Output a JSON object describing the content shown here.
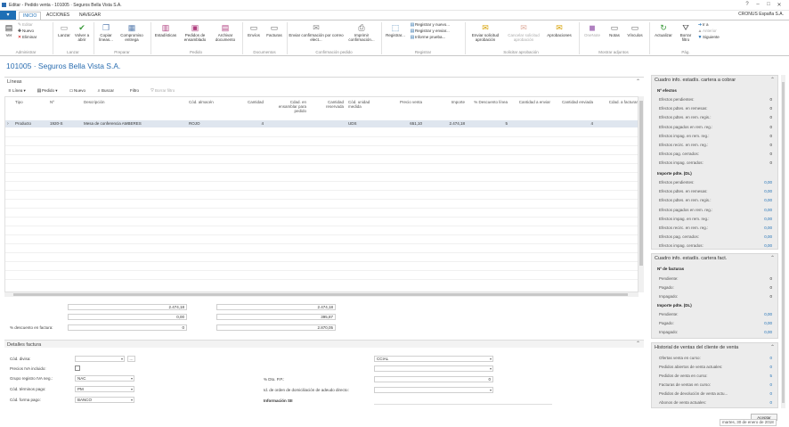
{
  "window": {
    "title": "Editar - Pedido venta - 101005 · Seguros Bella Vista S.A.",
    "company": "CRONUS España S.A."
  },
  "tabs": [
    "INICIO",
    "ACCIONES",
    "NAVEGAR"
  ],
  "ribbon": {
    "ver": "Ver",
    "editar": "Editar",
    "nuevo": "Nuevo",
    "eliminar": "Eliminar",
    "g_admin": "Administrar",
    "lanzar": "Lanzar",
    "volver_abrir": "Volver a abrir",
    "g_lanzar": "Lanzar",
    "copiar_lineas": "Copiar líneas...",
    "compromiso_entrega": "Compromiso entrega",
    "g_preparar": "Preparar",
    "estadisticas": "Estadísticas",
    "pedidos_ensamblado": "Pedidos de ensamblado",
    "archivar_doc": "Archivar documento",
    "g_pedido": "Pedido",
    "envios": "Envíos",
    "facturas": "Facturas",
    "g_documentos": "Documentos",
    "enviar_confirmacion": "Enviar confirmación por correo elect...",
    "imprimir_confirmacion": "Imprimir confirmación...",
    "g_confirmacion": "Confirmación pedido",
    "registrar": "Registrar...",
    "registrar_nuevo": "Registrar y nuevo...",
    "registrar_enviar": "Registrar y enviar...",
    "informe_prueba": "Informe prueba...",
    "g_registrar": "Registrar",
    "enviar_sol": "Enviar solicitud aprobación",
    "cancelar_sol": "Cancelar solicitud aprobación",
    "aprobaciones": "Aprobaciones",
    "g_sol": "Solicitar aprobación",
    "onenote": "OneNote",
    "notas": "Notas",
    "vinculos": "Vínculos",
    "g_adjuntos": "Mostrar adjuntos",
    "actualizar": "Actualizar",
    "borrar_filtro": "Borrar filtro",
    "ir_a": "Ir a",
    "anterior": "Anterior",
    "siguiente": "Siguiente",
    "g_pag": "Pág."
  },
  "doc_title": "101005 · Seguros Bella Vista S.A.",
  "lines": {
    "section": "Líneas",
    "toolbar": {
      "linea": "Línea",
      "pedido": "Pedido",
      "nuevo": "Nuevo",
      "buscar": "Buscar",
      "filtro": "Filtro",
      "borrar_filtro": "Borrar filtro"
    },
    "columns": [
      "Tipo",
      "Nº",
      "Descripción",
      "Cód. almacén",
      "Cantidad",
      "Cdad. en ensamblar para pedido",
      "Cantidad reservada",
      "Cód. unidad medida",
      "Precio venta",
      "Importe",
      "% Descuento línea",
      "Cantidad a enviar",
      "Cantidad enviada",
      "Cdad. a facturar"
    ],
    "rows": [
      {
        "tipo": "Producto",
        "no": "1920-S",
        "descripcion": "Mesa de conferencia AMBERES",
        "almacen": "ROJO",
        "cantidad": "4",
        "unidad": "UDS",
        "precio": "651,10",
        "importe": "2.474,18",
        "descuento": "5",
        "cdad_facturar": "4"
      }
    ]
  },
  "totals": {
    "left": [
      "2.474,18",
      "0,00",
      "0"
    ],
    "left_label3": "% descuento en factura:",
    "right": [
      "2.474,18",
      "395,87",
      "2.870,05"
    ]
  },
  "details": {
    "section": "Detalles factura",
    "cod_divisa": "Cód. divisa:",
    "precios_iva": "Precios IVA incluido:",
    "grupo_iva": "Grupo registro IVA neg.:",
    "grupo_iva_val": "NAC",
    "terminos_pago": "Cód. términos pago:",
    "terminos_pago_val": "PM",
    "forma_pago": "Cód. forma pago:",
    "forma_pago_val": "BANCO",
    "dto_pp": "% Dto. P.P.:",
    "dto_pp_val": "0",
    "domiciliacion": "Id. de orden de domiciliación de adeudo directo:",
    "info_sii": "Información SII",
    "ccial": "CCIAL"
  },
  "factbox": {
    "cartera_cobrar": {
      "title": "Cuadro info. estadís. cartera a cobrar",
      "sec1": "Nº efectos",
      "rows1": [
        {
          "label": "Efectos pendientes:",
          "value": "0"
        },
        {
          "label": "Efectos pdtes. en remesas:",
          "value": "0"
        },
        {
          "label": "Efectos pdtes. en rem. regis.:",
          "value": "0"
        },
        {
          "label": "Efectos pagados en rem. reg.:",
          "value": "0"
        },
        {
          "label": "Efectos impag. en rem. reg.:",
          "value": "0"
        },
        {
          "label": "Efectos recirc. en rem. reg.:",
          "value": "0"
        },
        {
          "label": "Efectos pag. cerrados:",
          "value": "0"
        },
        {
          "label": "Efectos impag. cerrados:",
          "value": "0"
        }
      ],
      "sec2": "Importe pdte. (DL)",
      "rows2": [
        {
          "label": "Efectos pendientes:",
          "value": "0,00"
        },
        {
          "label": "Efectos pdtes. en remesas:",
          "value": "0,00"
        },
        {
          "label": "Efectos pdtes. en rem. regis.:",
          "value": "0,00"
        },
        {
          "label": "Efectos pagados en rem. reg.:",
          "value": "0,00"
        },
        {
          "label": "Efectos impag. en rem. reg.:",
          "value": "0,00"
        },
        {
          "label": "Efectos recirc. en rem. reg.:",
          "value": "0,00"
        },
        {
          "label": "Efectos pag. cerrados:",
          "value": "0,00"
        },
        {
          "label": "Efectos impag. cerrados:",
          "value": "0,00"
        }
      ]
    },
    "cartera_fact": {
      "title": "Cuadro info. estadís. cartera fact.",
      "sec1": "Nº de facturas",
      "rows1": [
        {
          "label": "Pendiente:",
          "value": "0"
        },
        {
          "label": "Pagado:",
          "value": "0"
        },
        {
          "label": "Impagado:",
          "value": "0"
        }
      ],
      "sec2": "Importe pdte. (DL)",
      "rows2": [
        {
          "label": "Pendiente:",
          "value": "0,00"
        },
        {
          "label": "Pagado:",
          "value": "0,00"
        },
        {
          "label": "Impagado:",
          "value": "0,00"
        }
      ]
    },
    "historial": {
      "title": "Historial de ventas del cliente de venta",
      "rows": [
        {
          "label": "Ofertas venta en curso:",
          "value": "0"
        },
        {
          "label": "Pedidos abiertos de venta actuales:",
          "value": "0"
        },
        {
          "label": "Pedidos de venta en curso:",
          "value": "5"
        },
        {
          "label": "Facturas de ventas en curso:",
          "value": "0"
        },
        {
          "label": "Pedidos de devolución de venta actu...",
          "value": "0"
        },
        {
          "label": "Abonos de venta actuales:",
          "value": "0"
        }
      ]
    }
  },
  "footer": {
    "aceptar": "Aceptar",
    "date": "martes, 30 de enero de 2018"
  },
  "colors": {
    "accent": "#1e6fb5",
    "title": "#2a6db0",
    "selected_row": "#dfe6ef",
    "factbox_bg": "#ececec"
  }
}
